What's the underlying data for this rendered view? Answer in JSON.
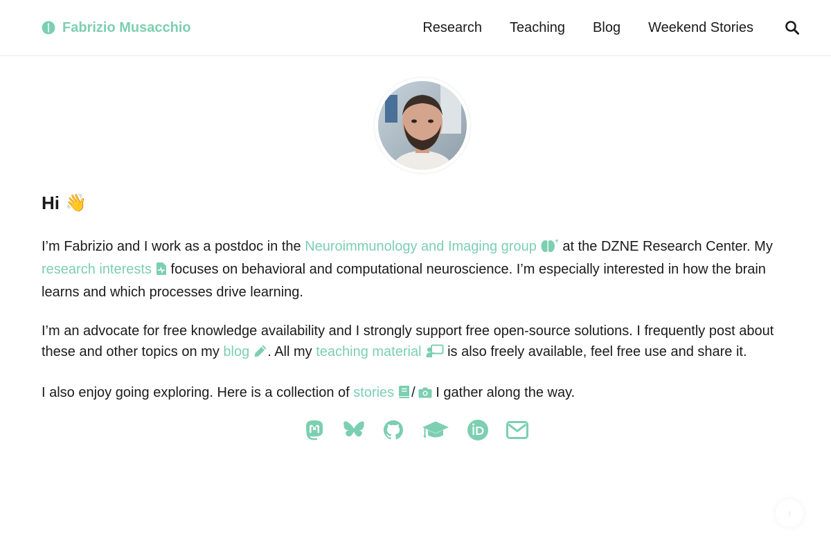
{
  "header": {
    "brand_icon": "brain-icon",
    "brand_name": "Fabrizio Musacchio",
    "nav": [
      "Research",
      "Teaching",
      "Blog",
      "Weekend Stories"
    ],
    "search_icon": "search-icon"
  },
  "profile": {
    "avatar": "profile-photo"
  },
  "greeting": {
    "text": "Hi",
    "emoji": "👋"
  },
  "intro": {
    "p1": {
      "t1": "I’m Fabrizio and I work as a postdoc in the ",
      "link1": "Neuroimmunology and Imaging group",
      "t2": " at the DZNE Research Center. My ",
      "link2": "research interests",
      "t3": " focuses on behavioral and computational neuroscience. I’m especially interested in how the brain learns and which processes drive learning."
    },
    "p2": {
      "t1": "I’m an advocate for free knowledge availability and I strongly support free open-source solutions. I frequently post about these and other topics on my ",
      "link1": "blog",
      "t2": ". All my ",
      "link2": "teaching material",
      "t3": " is also freely available, feel free use and share it."
    },
    "p3": {
      "t1": "I also enjoy going exploring. Here is a collection of ",
      "link1": "stories",
      "sep": "/",
      "t2": " I gather along the way."
    }
  },
  "socials": [
    "mastodon-icon",
    "bluesky-icon",
    "github-icon",
    "graduation-cap-icon",
    "orcid-icon",
    "envelope-icon"
  ],
  "to_top": "↑",
  "colors": {
    "accent": "#7ccfb1",
    "text": "#1a1a1a",
    "border": "#e9e9e9"
  }
}
